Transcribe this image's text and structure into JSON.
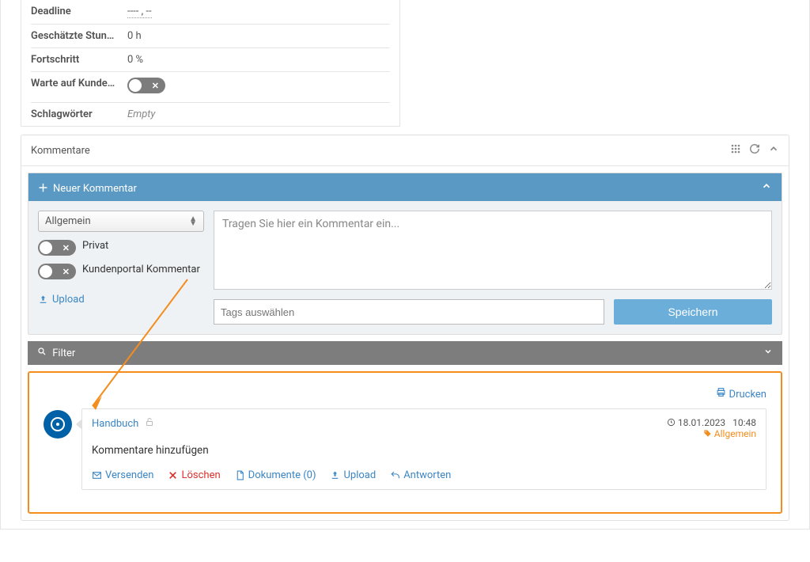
{
  "details": {
    "deadline_label": "Deadline",
    "deadline_value": "----          , --",
    "hours_label": "Geschätzte Stun…",
    "hours_value": "0 h",
    "progress_label": "Fortschritt",
    "progress_value": "0 %",
    "wait_label": "Warte auf Kunde…",
    "tags_label": "Schlagwörter",
    "tags_value": "Empty"
  },
  "comments_panel": {
    "title": "Kommentare"
  },
  "new_comment": {
    "title": "Neuer Kommentar",
    "category_selected": "Allgemein",
    "privat_label": "Privat",
    "portal_label": "Kundenportal Kommentar",
    "upload_label": "Upload",
    "textarea_placeholder": "Tragen Sie hier ein Kommentar ein...",
    "tags_placeholder": "Tags auswählen",
    "save_label": "Speichern"
  },
  "filter": {
    "label": "Filter"
  },
  "print_label": "Drucken",
  "comment": {
    "author": "Handbuch",
    "date": "18.01.2023",
    "time": "10:48",
    "category": "Allgemein",
    "text": "Kommentare hinzufügen",
    "send": "Versenden",
    "delete": "Löschen",
    "documents": "Dokumente (0)",
    "upload": "Upload",
    "reply": "Antworten"
  }
}
